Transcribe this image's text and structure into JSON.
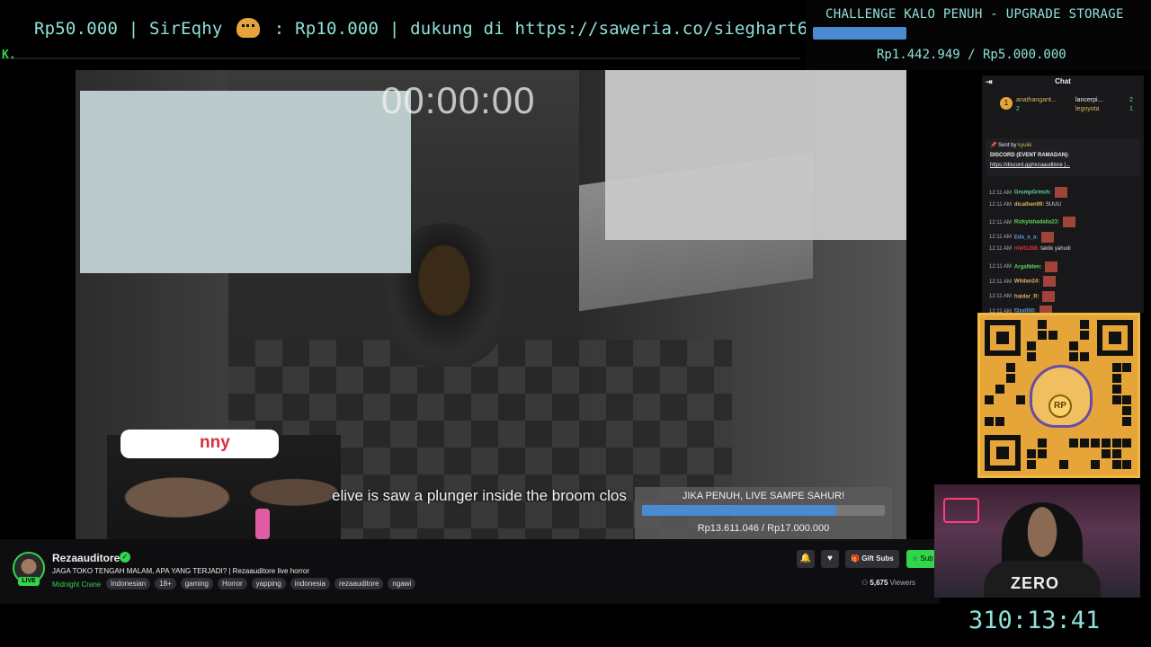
{
  "ticker": {
    "text_left": "Rp50.000 | SirEqhy",
    "text_right": ": Rp10.000 |  dukung di https://saweria.co/sieghart666",
    "mascot_icon": "hamster-emote-icon",
    "corner_text": "K."
  },
  "challenge": {
    "title": "CHALLENGE KALO PENUH - UPGRADE STORAGE",
    "amount": "Rp1.442.949 / Rp5.000.000",
    "progress": 0.29,
    "color": "#4a8ad0"
  },
  "game": {
    "timer": "00:00:00",
    "subtitle": "elive is saw a plunger inside the broom clos",
    "name_pill": "nny"
  },
  "goal": {
    "title": "JIKA PENUH, LIVE SAMPE SAHUR!",
    "amount": "Rp13.611.046 / Rp17.000.000",
    "progress": 0.8
  },
  "channel": {
    "name": "Rezaauditore",
    "live_badge": "LIVE",
    "title": "JAGA TOKO TENGAH MALAM, APA YANG TERJADI? | Rezaauditore live horror",
    "category": "Midnight Crane",
    "tags": [
      "Indonesian",
      "18+",
      "gaming",
      "Horror",
      "yapping",
      "indonesia",
      "rezaauditore",
      "ngawi"
    ],
    "gift_label": "Gift Subs",
    "sub_label": "Sub",
    "viewers_count": "5,675",
    "viewers_label": "Viewers",
    "accent": "#31d64d"
  },
  "chat": {
    "title": "Chat",
    "leaders": [
      {
        "name": "anathangant...",
        "count": "2"
      },
      {
        "name": "lancerpi...",
        "count": "2"
      },
      {
        "name": "legoyota",
        "count": "1"
      }
    ],
    "pinned_sent_by": "Sent by",
    "pinned_user": "kyuiki",
    "pinned_title": "DISCORD (EVENT RAMADAN):",
    "pinned_link": "https://discord.gg/rezaauditore |...",
    "messages": [
      {
        "time": "12:11 AM",
        "user": "GrumpGrinch:",
        "text": "",
        "color": "#5fd3a0",
        "emote": true
      },
      {
        "time": "12:11 AM",
        "user": "dicathen99:",
        "text": "SUUU",
        "color": "#e0b35a",
        "emote": false
      },
      {
        "time": "12:11 AM",
        "user": "Rizkylahadalia23:",
        "text": "",
        "color": "#5fd35f",
        "emote": true
      },
      {
        "time": "12:11 AM",
        "user": "Eda_a_a:",
        "text": "",
        "color": "#5a9ae0",
        "emote": true
      },
      {
        "time": "12:11 AM",
        "user": "nfell1288:",
        "text": "taktik yahudi",
        "color": "#d83040",
        "emote": false
      },
      {
        "time": "12:11 AM",
        "user": "ArgaNden:",
        "text": "",
        "color": "#5fd35f",
        "emote": true
      },
      {
        "time": "12:11 AM",
        "user": "Wildan24:",
        "text": "",
        "color": "#e0b35a",
        "emote": true
      },
      {
        "time": "12:11 AM",
        "user": "haidar_R:",
        "text": "",
        "color": "#e0b35a",
        "emote": true
      },
      {
        "time": "12:11 AM",
        "user": "f3xx000:",
        "text": "",
        "color": "#5a9ae0",
        "emote": true
      }
    ]
  },
  "qr": {
    "badge": "RP"
  },
  "webcam": {
    "shirt_text": "ZERO"
  },
  "uptime": "310:13:41"
}
